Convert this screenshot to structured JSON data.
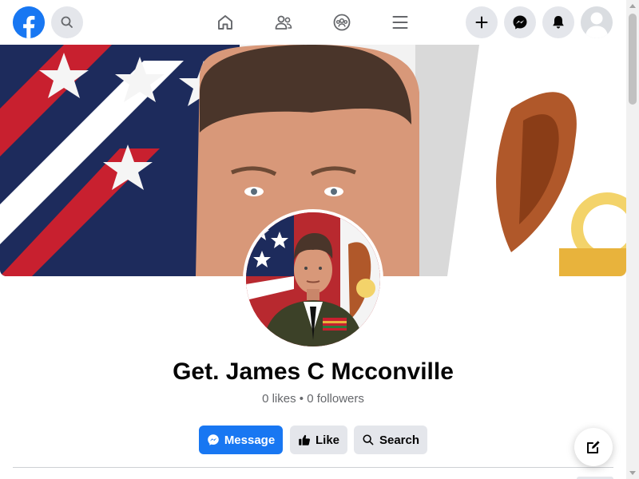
{
  "brand": {
    "accent": "#1877f2",
    "button_gray": "#e4e6eb",
    "text_secondary": "#65676b"
  },
  "topbar": {
    "logo_icon": "facebook-logo-icon",
    "search_icon": "search-icon",
    "nav_items": [
      {
        "name": "home",
        "icon": "home-icon"
      },
      {
        "name": "friends",
        "icon": "friends-icon"
      },
      {
        "name": "groups",
        "icon": "groups-icon"
      },
      {
        "name": "menu",
        "icon": "menu-icon"
      }
    ],
    "actions": [
      {
        "name": "create",
        "icon": "plus-icon"
      },
      {
        "name": "messenger",
        "icon": "messenger-icon"
      },
      {
        "name": "notifications",
        "icon": "bell-icon"
      },
      {
        "name": "account",
        "icon": "avatar-icon"
      }
    ]
  },
  "profile": {
    "name": "Get. James C Mcconville",
    "stats": "0 likes • 0 followers"
  },
  "actions": {
    "message_label": "Message",
    "like_label": "Like",
    "search_label": "Search"
  },
  "fab": {
    "icon": "compose-icon"
  }
}
